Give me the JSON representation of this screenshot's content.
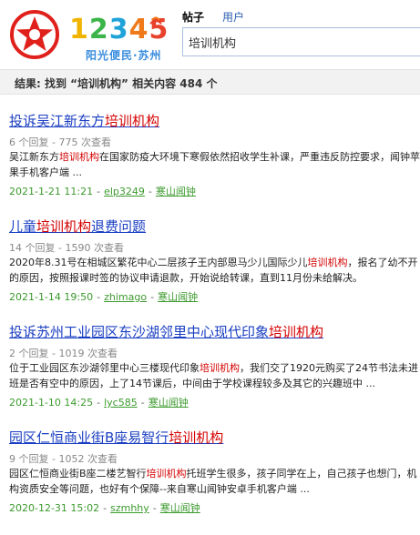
{
  "header": {
    "logo": {
      "number": [
        "1",
        "2",
        "3",
        "4",
        "5"
      ],
      "subtitle": "阳光便民·苏州",
      "colors": {
        "star": "#e0201b",
        "d1": "#f0b400",
        "d2": "#3bb54a",
        "d3": "#1fa3d9",
        "d4": "#f07a1a",
        "d5": "#e8412c"
      }
    },
    "tabs": [
      {
        "label": "帖子",
        "active": true
      },
      {
        "label": "用户",
        "active": false
      }
    ],
    "search": {
      "value": "培训机构"
    }
  },
  "summary": "结果: 找到 “培训机构” 相关内容 484 个",
  "results": [
    {
      "title_before": "投诉吴江新东方",
      "title_highlight": "培训机构",
      "title_after": "",
      "meta": "6 个回复 - 775 次查看",
      "snippet_before": "吴江新东方",
      "snippet_highlight": "培训机构",
      "snippet_after": "在国家防疫大环境下寒假依然招收学生补课，严重违反防控要求，闻钟苹果手机客户端 ...",
      "date": "2021-1-21 11:21",
      "user": "elp3249",
      "forum": "寒山闻钟"
    },
    {
      "title_before": "儿童",
      "title_highlight": "培训机构",
      "title_after": "退费问题",
      "meta": "14 个回复 - 1590 次查看",
      "snippet_before": "2020年8.31号在相城区繁花中心二层孩子王内部恩马少儿国际少儿",
      "snippet_highlight": "培训机构",
      "snippet_after": "，报名了幼不开的原因，按照报课时签的协议申请退款，开始说给转课，直到11月份未给解决。",
      "date": "2021-1-14 19:50",
      "user": "zhimago",
      "forum": "寒山闻钟"
    },
    {
      "title_before": "投诉苏州工业园区东沙湖邻里中心现代印象",
      "title_highlight": "培训机构",
      "title_after": "",
      "meta": "2 个回复 - 1019 次查看",
      "snippet_before": "位于工业园区东沙湖邻里中心三楼现代印象",
      "snippet_highlight": "培训机构",
      "snippet_after": "，我们交了1920元购买了24节书法未进班是否有空中的原因，上了14节课后，中间由于学校课程较多及其它的兴趣班中 ...",
      "date": "2021-1-10 14:25",
      "user": "lyc585",
      "forum": "寒山闻钟"
    },
    {
      "title_before": "园区仁恒商业街B座易智行",
      "title_highlight": "培训机构",
      "title_after": "",
      "meta": "9 个回复 - 1052 次查看",
      "snippet_before": "园区仁恒商业街B座二楼艺智行",
      "snippet_highlight": "培训机构",
      "snippet_after": "托班学生很多，孩子同学在上，自己孩子也想门，机构资质安全等问题，也好有个保障--来自寒山闻钟安卓手机客户端 ...",
      "date": "2020-12-31 15:02",
      "user": "szmhhy",
      "forum": "寒山闻钟"
    }
  ]
}
